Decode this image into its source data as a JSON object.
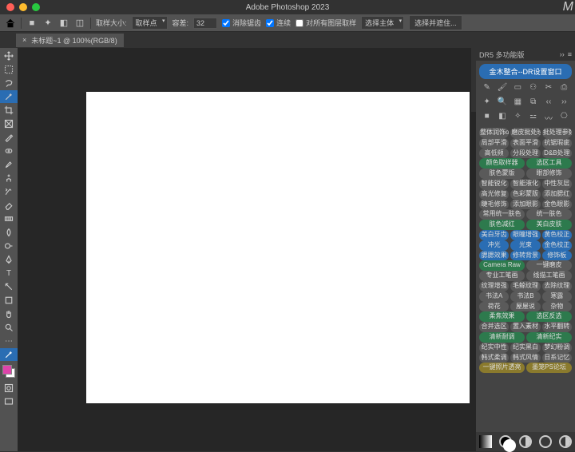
{
  "app_title": "Adobe Photoshop 2023",
  "doc_tab": "未标题~1 @ 100%(RGB/8)",
  "options": {
    "sample_label": "取样大小:",
    "sample_value": "取样点",
    "tol_label": "容差:",
    "tol_value": "32",
    "chk_aa": "消除锯齿",
    "chk_contig": "连续",
    "chk_layers": "对所有图层取样",
    "subj_label": "选择主体",
    "refine_label": "选择并遮住..."
  },
  "panel": {
    "title": "DR5 多功能版",
    "main_btn": "金木整合--DR设置窗口",
    "rows": [
      [
        {
          "t": "整体润饰on",
          "c": "g-gray"
        },
        {
          "t": "磨皮批处理",
          "c": "g-gray"
        },
        {
          "t": "批处理参数",
          "c": "g-gray"
        }
      ],
      [
        {
          "t": "局部平滑",
          "c": "g-gray"
        },
        {
          "t": "表面平滑",
          "c": "g-gray"
        },
        {
          "t": "抗锯瑕疵",
          "c": "g-gray"
        }
      ],
      [
        {
          "t": "高低频",
          "c": "g-gray"
        },
        {
          "t": "分段处理",
          "c": "g-gray"
        },
        {
          "t": "D&B处理",
          "c": "g-gray"
        }
      ],
      [
        {
          "t": "颜色取样器",
          "c": "g-green"
        },
        {
          "t": "",
          "c": ""
        },
        {
          "t": "选区工具",
          "c": "g-green"
        }
      ],
      [
        {
          "t": "肤色蒙版",
          "c": "g-gray"
        },
        {
          "t": "",
          "c": ""
        },
        {
          "t": "眼部修饰",
          "c": "g-gray"
        }
      ],
      [
        {
          "t": "智能锐化",
          "c": "g-gray"
        },
        {
          "t": "智能液化",
          "c": "g-gray"
        },
        {
          "t": "中性灰层",
          "c": "g-gray"
        }
      ],
      [
        {
          "t": "高光修复",
          "c": "g-gray"
        },
        {
          "t": "色彩蒙版",
          "c": "g-gray"
        },
        {
          "t": "添加腮红",
          "c": "g-gray"
        }
      ],
      [
        {
          "t": "睫毛修饰",
          "c": "g-gray"
        },
        {
          "t": "添加眼影",
          "c": "g-gray"
        },
        {
          "t": "金色眼影",
          "c": "g-gray"
        }
      ],
      [
        {
          "t": "常用统一肤色",
          "c": "g-gray"
        },
        {
          "t": "",
          "c": ""
        },
        {
          "t": "统一肤色",
          "c": "g-gray"
        }
      ],
      [
        {
          "t": "肤色减红",
          "c": "g-green"
        },
        {
          "t": "",
          "c": ""
        },
        {
          "t": "美白皮肤",
          "c": "g-green"
        }
      ],
      [
        {
          "t": "美白牙齿",
          "c": "g-blue"
        },
        {
          "t": "眼瞳增强",
          "c": "g-blue"
        },
        {
          "t": "黄色校正",
          "c": "g-blue"
        }
      ],
      [
        {
          "t": "冲光",
          "c": "g-blue"
        },
        {
          "t": "光束",
          "c": "g-blue"
        },
        {
          "t": "金色校正",
          "c": "g-blue"
        }
      ],
      [
        {
          "t": "腮腮效果",
          "c": "g-blue"
        },
        {
          "t": "修转背景",
          "c": "g-blue"
        },
        {
          "t": "修饰板",
          "c": "g-blue"
        }
      ],
      [
        {
          "t": "Camera Raw",
          "c": "g-green"
        },
        {
          "t": "",
          "c": ""
        },
        {
          "t": "一键磨皮",
          "c": "g-gray"
        }
      ],
      [
        {
          "t": "专业工笔画",
          "c": "g-gray"
        },
        {
          "t": "",
          "c": ""
        },
        {
          "t": "线描工笔画",
          "c": "g-gray"
        }
      ],
      [
        {
          "t": "纹理增强",
          "c": "g-gray"
        },
        {
          "t": "毛鲸纹理",
          "c": "g-gray"
        },
        {
          "t": "去除纹理",
          "c": "g-gray"
        }
      ],
      [
        {
          "t": "书法A",
          "c": "g-gray"
        },
        {
          "t": "书法B",
          "c": "g-gray"
        },
        {
          "t": "寒露",
          "c": "g-gray"
        }
      ],
      [
        {
          "t": "荷花",
          "c": "g-gray"
        },
        {
          "t": "屋屋说",
          "c": "g-gray"
        },
        {
          "t": "杂物",
          "c": "g-gray"
        }
      ],
      [
        {
          "t": "柔焦效果",
          "c": "g-green"
        },
        {
          "t": "",
          "c": ""
        },
        {
          "t": "选区反选",
          "c": "g-green"
        }
      ],
      [
        {
          "t": "合并选区",
          "c": "g-gray"
        },
        {
          "t": "置入素材",
          "c": "g-gray"
        },
        {
          "t": "水平翻转",
          "c": "g-gray"
        }
      ],
      [
        {
          "t": "清新耐调",
          "c": "g-green"
        },
        {
          "t": "",
          "c": ""
        },
        {
          "t": "清新纪实",
          "c": "g-green"
        }
      ],
      [
        {
          "t": "纪实中性",
          "c": "g-gray"
        },
        {
          "t": "纪实黑白",
          "c": "g-gray"
        },
        {
          "t": "梦幻粉调",
          "c": "g-gray"
        }
      ],
      [
        {
          "t": "韩式柔调",
          "c": "g-gray"
        },
        {
          "t": "韩式风情",
          "c": "g-gray"
        },
        {
          "t": "日系记忆",
          "c": "g-gray"
        }
      ],
      [
        {
          "t": "一键照片透亮",
          "c": "g-yell"
        },
        {
          "t": "",
          "c": ""
        },
        {
          "t": "墨笼PS论坛",
          "c": "g-yell"
        }
      ]
    ]
  }
}
